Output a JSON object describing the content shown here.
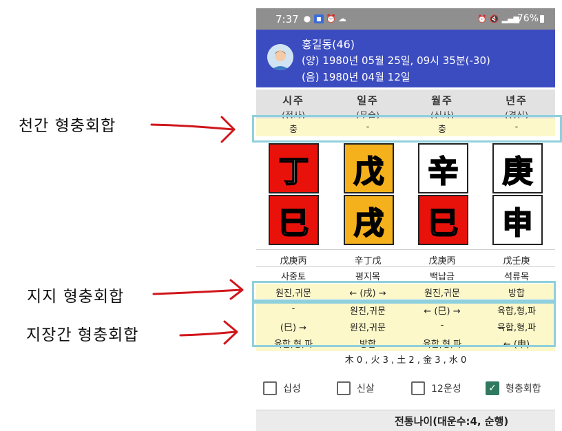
{
  "status": {
    "time": "7:37",
    "battery": "76%",
    "left_icons": [
      "chat-bubble-icon",
      "app-icon",
      "alarm-icon",
      "cloud-icon"
    ],
    "right_icons": [
      "alarm-icon",
      "mute-icon",
      "lte-signal-icon",
      "battery-icon"
    ]
  },
  "profile": {
    "name": "홍길동(46)",
    "solar": "(양) 1980년 05월 25일, 09시 35분(-30)",
    "lunar": "(음) 1980년 04월 12일"
  },
  "pillars": [
    {
      "title": "시주",
      "sub": "(정사)",
      "stem_relation": "충",
      "stem": "丁",
      "stem_color": "#e8120b",
      "branch": "巳",
      "branch_color": "#e8120b",
      "hidden": "戊庚丙",
      "napeum": "사중토",
      "branch_relation": "원진,귀문",
      "hidden_rel": [
        "-",
        "(巳) →",
        "육합,형,파"
      ]
    },
    {
      "title": "일주",
      "sub": "(무술)",
      "stem_relation": "-",
      "stem": "戊",
      "stem_color": "#f5b11b",
      "branch": "戌",
      "branch_color": "#f5b11b",
      "hidden": "辛丁戊",
      "napeum": "평지목",
      "branch_relation": "← (戌) →",
      "hidden_rel": [
        "원진,귀문",
        "원진,귀문",
        "방합"
      ]
    },
    {
      "title": "월주",
      "sub": "(신사)",
      "stem_relation": "충",
      "stem": "辛",
      "stem_color": "#ffffff",
      "branch": "巳",
      "branch_color": "#e8120b",
      "hidden": "戊庚丙",
      "napeum": "백납금",
      "branch_relation": "원진,귀문",
      "hidden_rel": [
        "← (巳) →",
        "-",
        "육합,형,파"
      ]
    },
    {
      "title": "년주",
      "sub": "(경신)",
      "stem_relation": "-",
      "stem": "庚",
      "stem_color": "#ffffff",
      "branch": "申",
      "branch_color": "#ffffff",
      "hidden": "戊壬庚",
      "napeum": "석류목",
      "branch_relation": "방합",
      "hidden_rel": [
        "육합,형,파",
        "육합,형,파",
        "← (申)"
      ]
    }
  ],
  "elements": "木 0 , 火 3 , 土 2 , 金 3 , 水 0",
  "options": [
    {
      "label": "십성",
      "checked": false
    },
    {
      "label": "신살",
      "checked": false
    },
    {
      "label": "12운성",
      "checked": false
    },
    {
      "label": "형충회합",
      "checked": true
    }
  ],
  "footer": "전통나이(대운수:4, 순행)",
  "annotations": {
    "stem": "천간 형충회합",
    "branch": "지지 형충회합",
    "hidden": "지장간 형충회합"
  },
  "colors": {
    "header": "#3b4cc0",
    "highlight": "#8fd0dc",
    "arrow": "#d0161b",
    "row_yellow": "#fdf8c9"
  }
}
